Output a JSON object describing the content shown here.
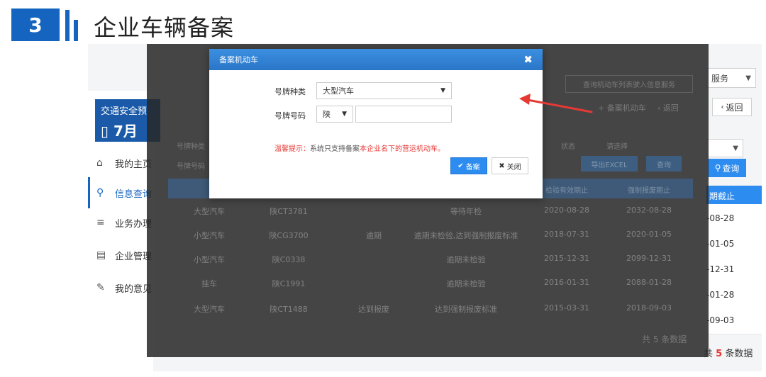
{
  "slide": {
    "number": "3",
    "title": "企业车辆备案"
  },
  "background": {
    "sidebar_card": {
      "line1": "交通安全预",
      "line2": "7月"
    },
    "sidebar_items": [
      {
        "label": "我的主页",
        "icon": "home-icon",
        "glyph": "⌂"
      },
      {
        "label": "信息查询",
        "icon": "search-icon",
        "glyph": "⚲"
      },
      {
        "label": "业务办理",
        "icon": "stack-icon",
        "glyph": "≡"
      },
      {
        "label": "企业管理",
        "icon": "document-icon",
        "glyph": "▤"
      },
      {
        "label": "我的意见",
        "icon": "feedback-icon",
        "glyph": "✎"
      }
    ],
    "service_select": "服务",
    "back_button": "返回",
    "filter_select": "",
    "query_button": "查询",
    "right_column": {
      "header": "期截止",
      "cells": [
        "-08-28",
        "-01-05",
        "-12-31",
        "-01-28",
        "-09-03"
      ]
    },
    "total_prefix": "共",
    "total_count": "5",
    "total_suffix": "条数据"
  },
  "overlay": {
    "top_select": "查询机动车列表驶入信息服务",
    "add_vehicle_link": "备案机动车",
    "back_link": "返回",
    "filter_left1": "号牌种类",
    "filter_left2": "号牌号码",
    "filter_right": "状态",
    "filter_right_value": "请选择",
    "export_button": "导出EXCEL",
    "query_button": "查询",
    "col_valid": "检验有效期止",
    "col_scrap": "强制报废期止",
    "rows": [
      {
        "type": "大型汽车",
        "plate": "陕CT3781",
        "status": "",
        "remark": "等待年检",
        "valid": "2020-08-28",
        "scrap": "2032-08-28"
      },
      {
        "type": "小型汽车",
        "plate": "陕CG3700",
        "status": "逾期",
        "remark": "逾期未检验,达到强制报废标准",
        "valid": "2018-07-31",
        "scrap": "2020-01-05"
      },
      {
        "type": "小型汽车",
        "plate": "陕C0338",
        "status": "",
        "remark": "逾期未检验",
        "valid": "2015-12-31",
        "scrap": "2099-12-31"
      },
      {
        "type": "挂车",
        "plate": "陕C1991",
        "status": "",
        "remark": "逾期未检验",
        "valid": "2016-01-31",
        "scrap": "2088-01-28"
      },
      {
        "type": "大型汽车",
        "plate": "陕CT1488",
        "status": "达到报废",
        "remark": "达到强制报废标准",
        "valid": "2015-03-31",
        "scrap": "2018-09-03"
      }
    ],
    "total_text": "共 5 条数据"
  },
  "modal": {
    "title": "备案机动车",
    "plate_type_label": "号牌种类",
    "plate_type_value": "大型汽车",
    "plate_no_label": "号牌号码",
    "plate_prefix": "陕",
    "plate_no_value": "",
    "tip_label": "温馨提示：",
    "tip_mid": "系统只支持备案",
    "tip_emphasis": "本企业名下的营运机动车。",
    "submit_label": "备案",
    "close_label": "关闭"
  },
  "colors": {
    "accent": "#2d8cf0",
    "brand": "#1565c0",
    "tip": "#e53935",
    "arrow": "#e53935"
  }
}
